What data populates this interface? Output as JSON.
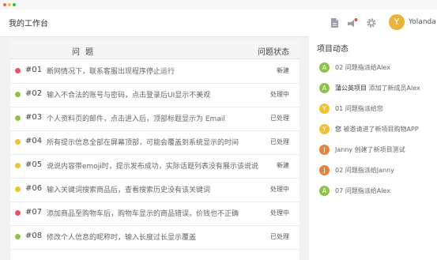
{
  "header": {
    "title": "我的工作台",
    "user": {
      "initial": "Y",
      "name": "Yolanda"
    },
    "icons": [
      "document-icon",
      "notification-bell-icon",
      "settings-gear-icon"
    ],
    "notification_dot_color": "#e74c3c"
  },
  "table": {
    "col_issue": "问 题",
    "col_status": "问题状态",
    "rows": [
      {
        "num": "#01",
        "desc": "断网情况下，联系客服出现程序停止运行",
        "status": "新建",
        "dot": "#ef4f62"
      },
      {
        "num": "#02",
        "desc": "输入不合法的账号与密码，点击登录后UI显示不美观",
        "status": "处理中",
        "dot": "#8bc34a"
      },
      {
        "num": "#03",
        "desc": "个人资料页的邮件，点击进入后，顶部标题显示为 Email",
        "status": "已处理",
        "dot": "#8bc34a"
      },
      {
        "num": "#04",
        "desc": "所有提示信息全部在屏幕顶部，可能会覆盖到系统显示的时间",
        "status": "已处理",
        "dot": "#f2c12e"
      },
      {
        "num": "#05",
        "desc": "说说内容带emoji时，提示发布成功，实际话题列表没有展示该说说",
        "status": "新建",
        "dot": "#f2c12e"
      },
      {
        "num": "#06",
        "desc": "输入关键词搜索商品后，查看搜索历史没有该关键词",
        "status": "处理中",
        "dot": "#f2c12e"
      },
      {
        "num": "#07",
        "desc": "添加商品至购物车后，购物车显示的商品错误，价钱也不正确",
        "status": "处理中",
        "dot": "#ef4f62"
      },
      {
        "num": "#08",
        "desc": "修改个人信息的昵称时，输入长度过长显示覆盖",
        "status": "已处理",
        "dot": "#8bc34a"
      }
    ]
  },
  "activity": {
    "title": "项目动态",
    "items": [
      {
        "initial": "A",
        "color": "#8bc34a",
        "lead": "",
        "text": "02 问题指派给Alex"
      },
      {
        "initial": "A",
        "color": "#8bc34a",
        "lead": "蒲公英项目",
        "text": " 添加了新成员Alex"
      },
      {
        "initial": "Y",
        "color": "#f2c12e",
        "lead": "",
        "text": "01 问题指派给您"
      },
      {
        "initial": "Y",
        "color": "#f2c12e",
        "lead": "您",
        "text": " 被邀请进了新项目购物APP"
      },
      {
        "initial": "J",
        "color": "#e8823a",
        "lead": "",
        "text": "Janny 创建了新项目测试"
      },
      {
        "initial": "J",
        "color": "#e8823a",
        "lead": "",
        "text": "02 问题指派给Janny"
      },
      {
        "initial": "A",
        "color": "#8bc34a",
        "lead": "",
        "text": "07 问题指派给Alex"
      }
    ]
  }
}
